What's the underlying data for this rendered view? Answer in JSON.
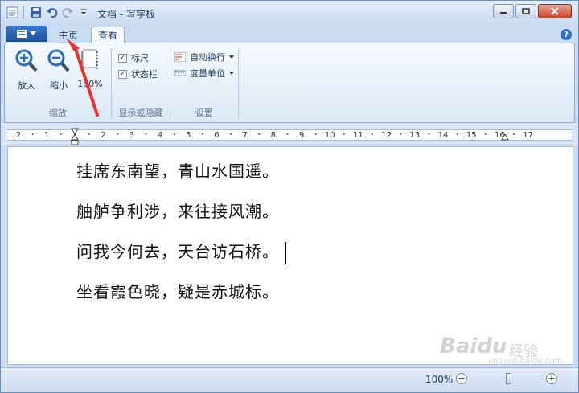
{
  "window": {
    "title": "文档 - 写字板"
  },
  "tabs": {
    "home": "主页",
    "view": "查看"
  },
  "ribbon": {
    "zoom_group": {
      "label": "缩放",
      "zoom_in": "放大",
      "zoom_out": "缩小",
      "percent100": "100%"
    },
    "show_hide_group": {
      "label": "显示或隐藏",
      "ruler": "标尺",
      "statusbar": "状态栏",
      "ruler_checked": true,
      "statusbar_checked": true
    },
    "settings_group": {
      "label": "设置",
      "word_wrap": "自动换行",
      "units": "度量单位"
    }
  },
  "ruler": {
    "labels": [
      "2",
      "1",
      "1",
      "2",
      "3",
      "4",
      "5",
      "6",
      "7",
      "8",
      "9",
      "10",
      "11",
      "12",
      "13",
      "14",
      "15",
      "16",
      "17"
    ]
  },
  "document": {
    "lines": [
      "挂席东南望，青山水国遥。",
      "舳舻争利涉，来往接风潮。",
      "问我今何去，天台访石桥。",
      "坐看霞色晓，疑是赤城标。"
    ]
  },
  "statusbar": {
    "zoom": "100%",
    "zoom_minus": "−",
    "zoom_plus": "+",
    "zoom_level": 0.5
  },
  "watermark": {
    "logo": "Baidu",
    "cn": "经验",
    "url": "jingyan.baidu.com"
  },
  "colors": {
    "accent": "#2d6fc4",
    "annotation_arrow": "#e8322a"
  }
}
